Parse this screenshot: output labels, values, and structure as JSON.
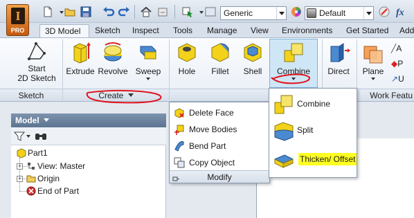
{
  "app": {
    "logo_letter": "I",
    "edition": "PRO"
  },
  "quick_access": {
    "material_value": "Generic",
    "appearance_value": "Default",
    "icons": [
      "new-icon",
      "open-icon",
      "save-icon",
      "undo-icon",
      "redo-icon",
      "home-icon",
      "return-icon",
      "select-icon",
      "color-icon",
      "help-icon"
    ]
  },
  "tabs": [
    {
      "label": "3D Model",
      "active": true
    },
    {
      "label": "Sketch"
    },
    {
      "label": "Inspect"
    },
    {
      "label": "Tools"
    },
    {
      "label": "Manage"
    },
    {
      "label": "View"
    },
    {
      "label": "Environments"
    },
    {
      "label": "Get Started"
    },
    {
      "label": "Add"
    }
  ],
  "ribbon": {
    "start_sketch": {
      "line1": "Start",
      "line2": "2D Sketch"
    },
    "extrude": "Extrude",
    "revolve": "Revolve",
    "sweep": "Sweep",
    "hole": "Hole",
    "fillet": "Fillet",
    "shell": "Shell",
    "combine": "Combine",
    "direct": "Direct",
    "plane": "Plane",
    "work_small": [
      "A",
      "P",
      "U"
    ],
    "panels": {
      "sketch": "Sketch",
      "create": "Create",
      "modify": "Modify",
      "work_features": "Work Featu"
    }
  },
  "browser": {
    "header": "Model",
    "tree": [
      {
        "label": "Part1"
      },
      {
        "label": "View: Master"
      },
      {
        "label": "Origin"
      },
      {
        "label": "End of Part"
      }
    ]
  },
  "modify_menu": {
    "items": [
      {
        "label": "Delete Face"
      },
      {
        "label": "Move Bodies"
      },
      {
        "label": "Bend Part"
      },
      {
        "label": "Copy Object"
      }
    ],
    "footer": "Modify"
  },
  "combine_menu": {
    "items": [
      {
        "label": "Combine"
      },
      {
        "label": "Split"
      },
      {
        "label": "Thicken/ Offset",
        "highlighted": true
      }
    ]
  },
  "colors": {
    "annotation_red": "#e0141e",
    "highlight_yellow": "#ffff22",
    "tool_yellow": "#f2d21a",
    "accent_blue": "#2a67b8"
  }
}
